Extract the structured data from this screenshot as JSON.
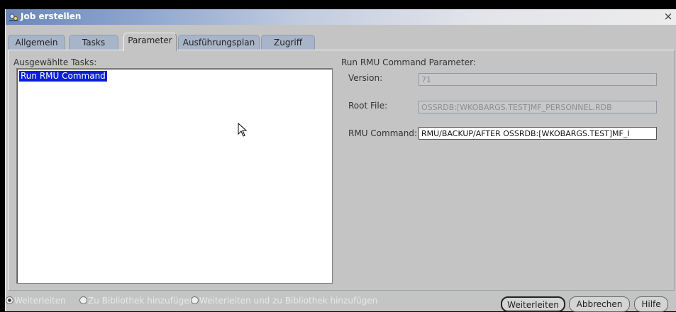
{
  "window": {
    "title": "Job erstellen",
    "close_label": "×"
  },
  "tabs": [
    "Allgemein",
    "Tasks",
    "Parameter",
    "Ausführungsplan",
    "Zugriff"
  ],
  "selected_tab": "Parameter",
  "left": {
    "label": "Ausgewählte Tasks:",
    "items": [
      "Run RMU Command"
    ]
  },
  "right": {
    "title": "Run RMU Command Parameter:",
    "version_label": "Version:",
    "version_value": "71",
    "root_label": "Root File:",
    "root_value": "OSSRDB:[WKOBARGS.TEST]MF_PERSONNEL.RDB",
    "command_label": "RMU Command:",
    "command_value": "RMU/BACKUP/AFTER OSSRDB:[WKOBARGS.TEST]MF_I"
  },
  "bottom": {
    "radios": [
      "Weiterleiten",
      "Zu Bibliothek hinzufügen",
      "Weiterleiten und zu Bibliothek hinzufügen"
    ],
    "radio_selected": 0,
    "buttons": {
      "forward": "Weiterleiten",
      "cancel": "Abbrechen",
      "help": "Hilfe"
    }
  }
}
